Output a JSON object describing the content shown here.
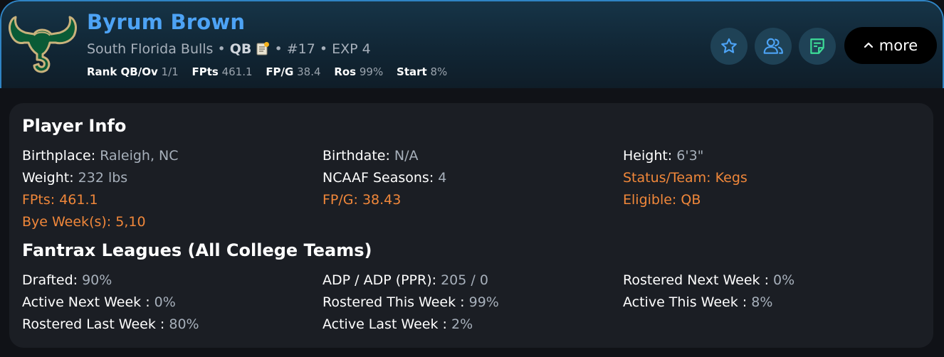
{
  "player": {
    "name": "Byrum Brown",
    "team": "South Florida Bulls",
    "sep1": " • ",
    "position": "QB",
    "sep2": " • ",
    "number": "#17",
    "sep3": " • ",
    "exp": "EXP 4"
  },
  "stats": {
    "rank_label": "Rank QB/Ov",
    "rank_value": "1/1",
    "fpts_label": "FPts",
    "fpts_value": "461.1",
    "fpg_label": "FP/G",
    "fpg_value": "38.4",
    "ros_label": "Ros",
    "ros_value": "99%",
    "start_label": "Start",
    "start_value": "8%"
  },
  "actions": {
    "favorite_icon": "star-icon",
    "compare_icon": "users-icon",
    "notes_icon": "sticky-note-icon",
    "more_label": "more"
  },
  "player_info": {
    "title": "Player Info",
    "birthplace_label": "Birthplace:",
    "birthplace_value": "Raleigh, NC",
    "birthdate_label": "Birthdate:",
    "birthdate_value": "N/A",
    "height_label": "Height:",
    "height_value": "6'3\"",
    "weight_label": "Weight:",
    "weight_value": "232 lbs",
    "seasons_label": "NCAAF Seasons:",
    "seasons_value": "4",
    "status_label": "Status/Team:",
    "status_value": "Kegs",
    "fpts_label": "FPts:",
    "fpts_value": "461.1",
    "fpg_label": "FP/G:",
    "fpg_value": "38.43",
    "eligible_label": "Eligible:",
    "eligible_value": "QB",
    "bye_label": "Bye Week(s):",
    "bye_value": "5,10"
  },
  "leagues": {
    "title": "Fantrax Leagues (All College Teams)",
    "drafted_label": "Drafted:",
    "drafted_value": "90%",
    "adp_label": "ADP / ADP (PPR):",
    "adp_value": "205 / 0",
    "rostered_next_label": "Rostered Next Week :",
    "rostered_next_value": "0%",
    "active_next_label": "Active Next Week :",
    "active_next_value": "0%",
    "rostered_this_label": "Rostered This Week :",
    "rostered_this_value": "99%",
    "active_this_label": "Active This Week :",
    "active_this_value": "8%",
    "rostered_last_label": "Rostered Last Week :",
    "rostered_last_value": "80%",
    "active_last_label": "Active Last Week :",
    "active_last_value": "2%"
  },
  "colors": {
    "name_blue": "#4da3f5",
    "accent_orange": "#f0873a",
    "logo_green": "#0a5b36",
    "logo_gold": "#c9b27c"
  }
}
